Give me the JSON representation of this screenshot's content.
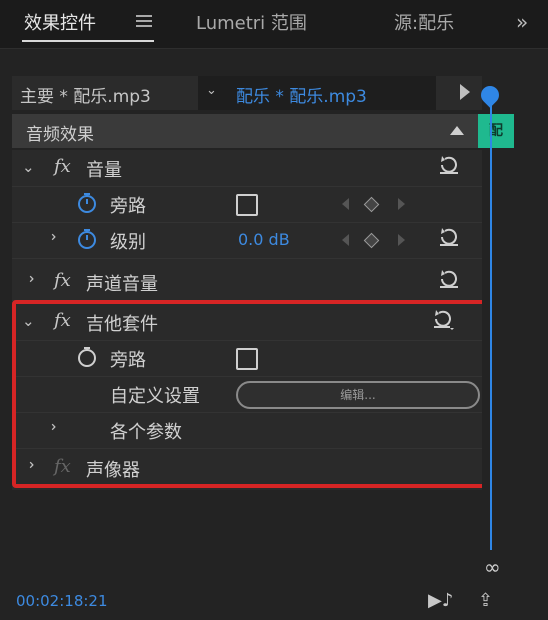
{
  "tabs": {
    "effect_controls": "效果控件",
    "lumetri": "Lumetri 范围",
    "source": "源:配乐",
    "more": "»"
  },
  "clip_header": {
    "master": "主要 * 配乐.mp3",
    "selected": "配乐 * 配乐.mp3",
    "mini_clip_label": "配"
  },
  "section": {
    "title": "音频效果"
  },
  "effects": [
    {
      "name": "音量",
      "fx": "fx"
    },
    {
      "name": "旁路"
    },
    {
      "name": "级别",
      "value": "0.0 dB"
    },
    {
      "name": "声道音量",
      "fx": "fx"
    },
    {
      "name": "吉他套件",
      "fx": "fx"
    },
    {
      "name": "旁路"
    },
    {
      "name": "自定义设置",
      "button": "编辑..."
    },
    {
      "name": "各个参数"
    },
    {
      "name": "声像器",
      "fx": "fx"
    }
  ],
  "footer": {
    "timecode": "00:02:18:21"
  },
  "colors": {
    "accent_blue": "#3d8ae0",
    "highlight_red": "#d62525",
    "clip_green": "#1fb98f"
  }
}
